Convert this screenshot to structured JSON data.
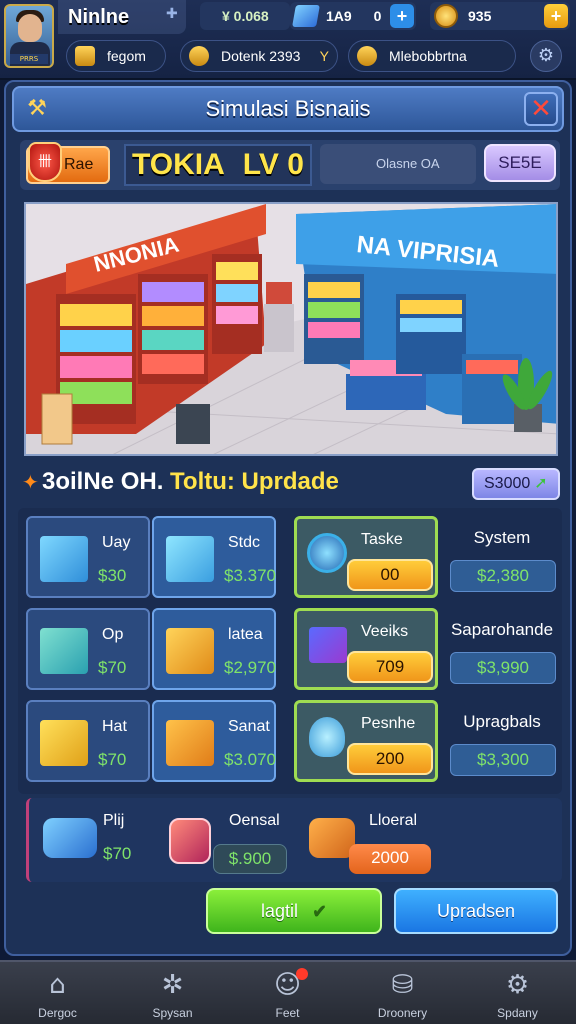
{
  "player": {
    "name": "Ninlne",
    "tag": "PRRS"
  },
  "currencies": {
    "money": "¥ 0.068",
    "gems": "1A9",
    "gems_extra": "0",
    "coins": "935"
  },
  "sub_stats": [
    {
      "label": "fegom"
    },
    {
      "label": "Dotenk 2393",
      "arrow": "Y"
    },
    {
      "label": "Mlebobbrtna"
    }
  ],
  "panel": {
    "title": "Simulasi Bisnaiis",
    "store_badge": "Rae",
    "store_name": "TOKIA",
    "store_level": "LV 0",
    "store_status": "Olasne OA",
    "store_button": "SE5E"
  },
  "scene": {
    "sign_left": "NNONIA",
    "sign_right": "NA VIPRISIA"
  },
  "upgrade": {
    "title_prefix": "3oilNe  OH.",
    "title_highlight": "Toltu: Uprdade",
    "cost": "S3000"
  },
  "grid": {
    "row1": [
      {
        "label": "Uay",
        "price": "$30"
      },
      {
        "label": "Stdc",
        "price": "$3.370"
      },
      {
        "label": "Taske",
        "price": "00"
      },
      {
        "label": "System",
        "price": "$2,380"
      }
    ],
    "row2": [
      {
        "label": "Op",
        "price": "$70"
      },
      {
        "label": "latea",
        "price": "$2,970"
      },
      {
        "label": "Veeiks",
        "price": "709"
      },
      {
        "label": "Saparohande",
        "price": "$3,990"
      }
    ],
    "row3": [
      {
        "label": "Hat",
        "price": "$70"
      },
      {
        "label": "Sanat",
        "price": "$3.070"
      },
      {
        "label": "Pesnhe",
        "price": "200"
      },
      {
        "label": "Upragbals",
        "price": "$3,300"
      }
    ]
  },
  "bottom_items": [
    {
      "label": "Plij",
      "price": "$70"
    },
    {
      "label": "Oensal",
      "price": "$.900"
    },
    {
      "label": "Lloeral",
      "price": "2000"
    }
  ],
  "actions": {
    "green": "lagtil",
    "blue": "Upradsen"
  },
  "nav": [
    {
      "label": "Dergoc"
    },
    {
      "label": "Spysan"
    },
    {
      "label": "Feet"
    },
    {
      "label": "Droonery"
    },
    {
      "label": "Spdany"
    }
  ],
  "colors": {
    "accent_gold": "#ffe54a",
    "price_green": "#7fe36a",
    "action_green": "#3fb41c",
    "action_blue": "#1a76e3"
  }
}
